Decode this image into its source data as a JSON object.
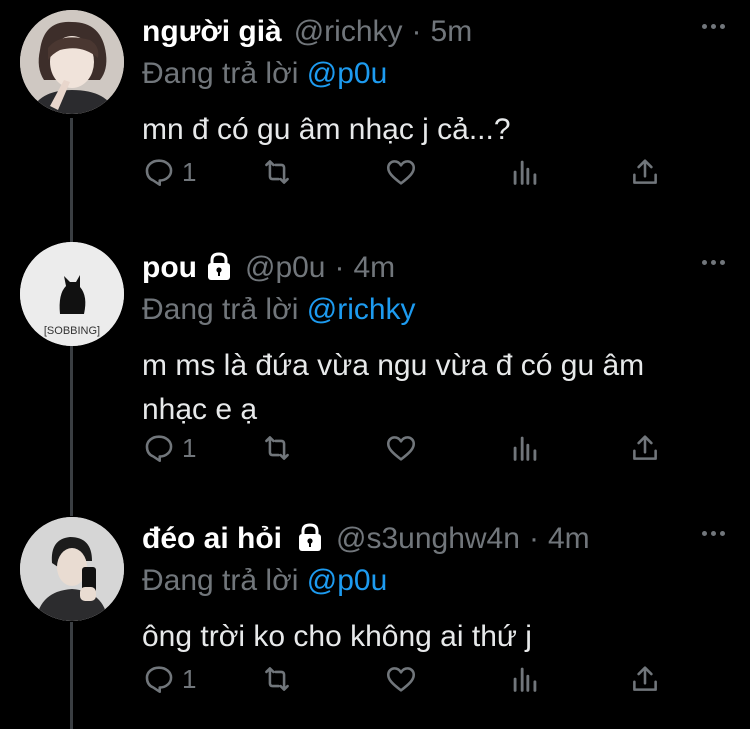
{
  "tweets": [
    {
      "name": "người già",
      "handle": "@richky",
      "dot": "·",
      "time": "5m",
      "locked": false,
      "reply_prefix": "Đang trả lời ",
      "reply_to": "@p0u",
      "text": "mn đ có gu âm nhạc j cả...?",
      "reply_count": "1",
      "avatar": "person-portrait"
    },
    {
      "name": "pou",
      "handle": "@p0u",
      "dot": "·",
      "time": "4m",
      "locked": true,
      "reply_prefix": "Đang trả lời ",
      "reply_to": "@richky",
      "text": "m ms là đứa vừa ngu vừa đ có gu âm nhạc e ạ",
      "reply_count": "1",
      "avatar": "black-cat",
      "avatar_caption": "[SOBBING]"
    },
    {
      "name": "đéo ai hỏi",
      "handle": "@s3unghw4n",
      "dot": "·",
      "time": "4m",
      "locked": true,
      "reply_prefix": "Đang trả lời ",
      "reply_to": "@p0u",
      "text": "ông trời ko cho không ai thứ j",
      "reply_count": "1",
      "avatar": "mirror-selfie"
    }
  ],
  "colors": {
    "background": "#000000",
    "secondary_text": "#71767b",
    "mention": "#1d9bf0",
    "thread_line": "#3a3e42"
  },
  "icons": [
    "reply-icon",
    "retweet-icon",
    "like-icon",
    "analytics-icon",
    "share-icon",
    "more-icon",
    "lock-icon"
  ]
}
